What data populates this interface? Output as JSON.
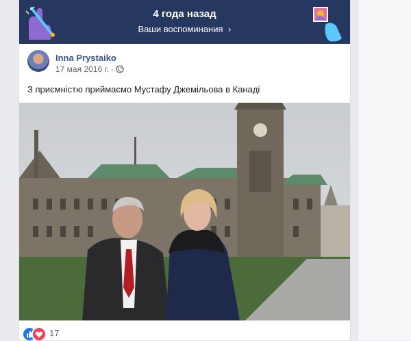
{
  "banner": {
    "title": "4 года назад",
    "subtitle": "Ваши воспоминания",
    "chevron": "›"
  },
  "post": {
    "author": "Inna Prystaiko",
    "date": "17 мая 2016 г.",
    "text": "З приємністю приймаємо Мустафу Джемільова в Канаді",
    "privacy_icon": "globe-icon"
  },
  "reactions": {
    "count": "17",
    "types": [
      "like-icon",
      "love-icon"
    ]
  },
  "colors": {
    "banner_bg": "#263860",
    "link": "#385898",
    "like": "#1877f2",
    "love": "#f33e58"
  }
}
